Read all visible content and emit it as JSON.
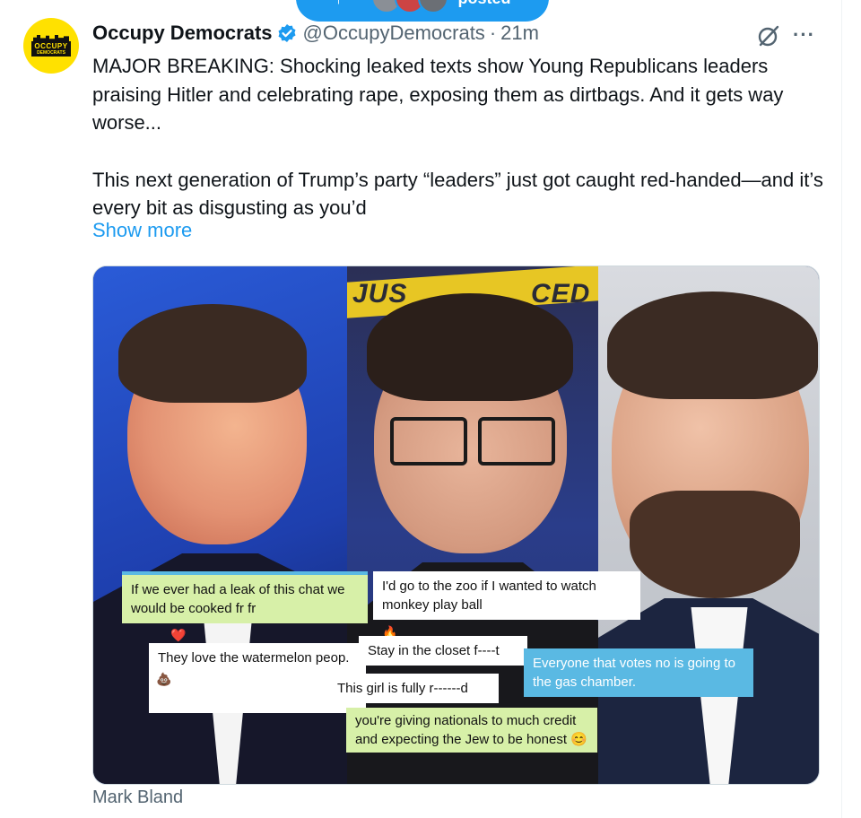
{
  "banner": {
    "label": "posted"
  },
  "account": {
    "name": "Occupy Democrats",
    "handle": "@OccupyDemocrats",
    "separator": "·",
    "time": "21m",
    "logo_text": "OCCUPY",
    "logo_subtext": "DEMOCRATS"
  },
  "tweet": {
    "paragraph1": "MAJOR BREAKING: Shocking leaked texts show Young Republicans leaders praising Hitler and celebrating rape, exposing them as dirtbags. And it gets way worse...",
    "paragraph2": "This next generation of Trump’s party “leaders” just got caught red-handed—and it’s every bit as disgusting as you’d",
    "show_more": "Show more"
  },
  "media": {
    "sign_left": "JUS",
    "sign_right": "CED",
    "chat_messages": [
      {
        "id": "leak",
        "text": "If we ever had a leak of this chat we would be cooked fr fr",
        "style": "green"
      },
      {
        "id": "zoo",
        "text": "I'd go to the zoo if I wanted to watch monkey play ball",
        "style": "white"
      },
      {
        "id": "watermelon",
        "text": "They love the watermelon peop.",
        "style": "white"
      },
      {
        "id": "closet",
        "text": "Stay in the closet f----t",
        "style": "white"
      },
      {
        "id": "gas",
        "text": "Everyone that votes no is going to the gas chamber.",
        "style": "blue"
      },
      {
        "id": "girl",
        "text": "This girl is fully r------d",
        "style": "white"
      },
      {
        "id": "nationals",
        "text": "you're giving nationals to much credit and expecting the Jew to be honest",
        "style": "green"
      }
    ],
    "reactions": {
      "heart": "❤️",
      "fire": "🔥",
      "poop": "💩",
      "smile": "😊"
    }
  },
  "caption": "Mark Bland",
  "colors": {
    "accent": "#1d9bf0",
    "muted": "#536471",
    "chat_green": "#d7f0a8",
    "chat_blue": "#5ab9e3"
  },
  "icons": {
    "verified": "verified-badge-icon",
    "grok": "grok-icon",
    "more": "more-icon",
    "repost": "repost-icon"
  }
}
